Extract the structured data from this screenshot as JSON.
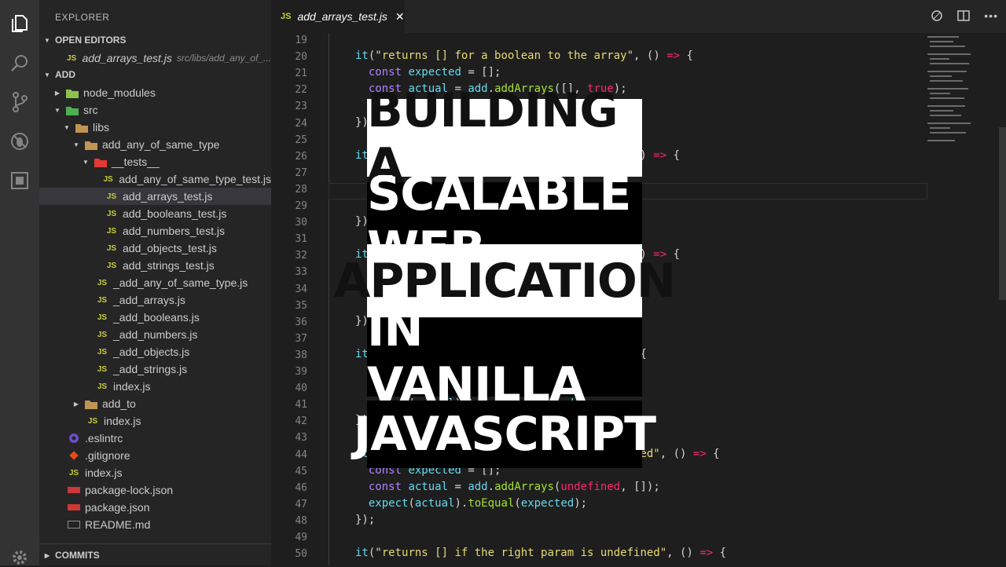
{
  "sidebar": {
    "title": "EXPLORER",
    "open_editors": {
      "header": "OPEN EDITORS",
      "items": [
        {
          "label": "add_arrays_test.js",
          "description": "src/libs/add_any_of_..."
        }
      ]
    },
    "folder": {
      "header": "ADD",
      "tree": [
        {
          "label": "node_modules",
          "icon": "folder-node-icon"
        },
        {
          "label": "src",
          "icon": "folder-src-icon"
        },
        {
          "label": "libs",
          "icon": "folder-icon"
        },
        {
          "label": "add_any_of_same_type",
          "icon": "folder-icon"
        },
        {
          "label": "__tests__",
          "icon": "folder-tests-icon"
        },
        {
          "label": "add_any_of_same_type_test.js",
          "icon": "js-file-icon"
        },
        {
          "label": "add_arrays_test.js",
          "icon": "js-file-icon"
        },
        {
          "label": "add_booleans_test.js",
          "icon": "js-file-icon"
        },
        {
          "label": "add_numbers_test.js",
          "icon": "js-file-icon"
        },
        {
          "label": "add_objects_test.js",
          "icon": "js-file-icon"
        },
        {
          "label": "add_strings_test.js",
          "icon": "js-file-icon"
        },
        {
          "label": "_add_any_of_same_type.js",
          "icon": "js-file-icon"
        },
        {
          "label": "_add_arrays.js",
          "icon": "js-file-icon"
        },
        {
          "label": "_add_booleans.js",
          "icon": "js-file-icon"
        },
        {
          "label": "_add_numbers.js",
          "icon": "js-file-icon"
        },
        {
          "label": "_add_objects.js",
          "icon": "js-file-icon"
        },
        {
          "label": "_add_strings.js",
          "icon": "js-file-icon"
        },
        {
          "label": "index.js",
          "icon": "js-file-icon"
        },
        {
          "label": "add_to",
          "icon": "folder-icon"
        },
        {
          "label": "index.js",
          "icon": "js-file-icon"
        },
        {
          "label": ".eslintrc",
          "icon": "eslint-icon"
        },
        {
          "label": ".gitignore",
          "icon": "git-icon"
        },
        {
          "label": "index.js",
          "icon": "js-file-icon"
        },
        {
          "label": "package-lock.json",
          "icon": "npm-icon"
        },
        {
          "label": "package.json",
          "icon": "npm-icon"
        },
        {
          "label": "README.md",
          "icon": "markdown-icon"
        }
      ]
    },
    "commits_header": "COMMITS"
  },
  "tab": {
    "badge": "JS",
    "label": "add_arrays_test.js",
    "close": "✕"
  },
  "editor": {
    "line_numbers": [
      "19",
      "20",
      "21",
      "22",
      "23",
      "24",
      "25",
      "26",
      "27",
      "28",
      "29",
      "30",
      "31",
      "32",
      "33",
      "34",
      "35",
      "36",
      "37",
      "38",
      "39",
      "40",
      "41",
      "42",
      "43",
      "44",
      "45",
      "46",
      "47",
      "48",
      "49",
      "50"
    ],
    "lines": [
      "",
      "it(\"returns [] for a boolean to the array\", () => {",
      "  const expected = [];",
      "  const actual = add.addArrays([], true);",
      "",
      "});",
      "",
      "it                                        () => {",
      "  const expected = [];",
      "  const actual = add.addArrays([], {});",
      "  expect(actual).toEqual(expected);",
      "});",
      "",
      "it                                        () => {",
      "",
      "",
      "",
      "});",
      "",
      "it(\"returns [] for undefined input\", () => {",
      "  const expected = [];",
      "  const actual = add.addArrays();",
      "  expect(actual).toEqual(expected);",
      "});",
      "",
      "it(\"returns [] if the left param is undefined\", () => {",
      "  const expected = [];",
      "  const actual = add.addArrays(undefined, []);",
      "  expect(actual).toEqual(expected);",
      "});",
      "",
      "it(\"returns [] if the right param is undefined\", () => {"
    ]
  },
  "overlay_title": [
    "BUILDING A",
    "SCALABLE WEB",
    "APPLICATION",
    "IN VANILLA",
    "JAVASCRIPT"
  ]
}
